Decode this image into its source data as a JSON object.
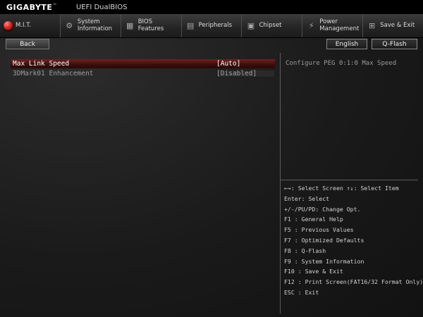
{
  "header": {
    "brand": "GIGABYTE",
    "trademark": "™",
    "subtitle": "UEFI DualBIOS"
  },
  "tabs": [
    {
      "label": "M.I.T.",
      "icon": "mit-icon",
      "active": true
    },
    {
      "label": "System Information",
      "icon": "gear-icon",
      "active": false
    },
    {
      "label": "BIOS Features",
      "icon": "chip-icon",
      "active": false
    },
    {
      "label": "Peripherals",
      "icon": "peripherals-icon",
      "active": false
    },
    {
      "label": "Chipset",
      "icon": "chipset-icon",
      "active": false
    },
    {
      "label": "Power Management",
      "icon": "power-icon",
      "active": false
    },
    {
      "label": "Save & Exit",
      "icon": "save-exit-icon",
      "active": false
    }
  ],
  "toolbar": {
    "back_label": "Back",
    "language_label": "English",
    "qflash_label": "Q-Flash"
  },
  "settings": [
    {
      "label": "Max Link Speed",
      "value": "[Auto]",
      "selected": true
    },
    {
      "label": "3DMark01 Enhancement",
      "value": "[Disabled]",
      "selected": false
    }
  ],
  "help_panel": {
    "description": "Configure PEG 0:1:0 Max Speed"
  },
  "key_legend": [
    "←→: Select Screen ↑↓: Select Item",
    "Enter: Select",
    "+/-/PU/PD: Change Opt.",
    "F1 : General Help",
    "F5 : Previous Values",
    "F7 : Optimized Defaults",
    "F8 : Q-Flash",
    "F9 : System Information",
    "F10 : Save & Exit",
    "F12 : Print Screen(FAT16/32 Format Only)",
    "ESC : Exit"
  ],
  "colors": {
    "accent_red": "#d61f1f",
    "selected_row": "#3c0d0d",
    "panel_border": "#5c5c5c"
  }
}
